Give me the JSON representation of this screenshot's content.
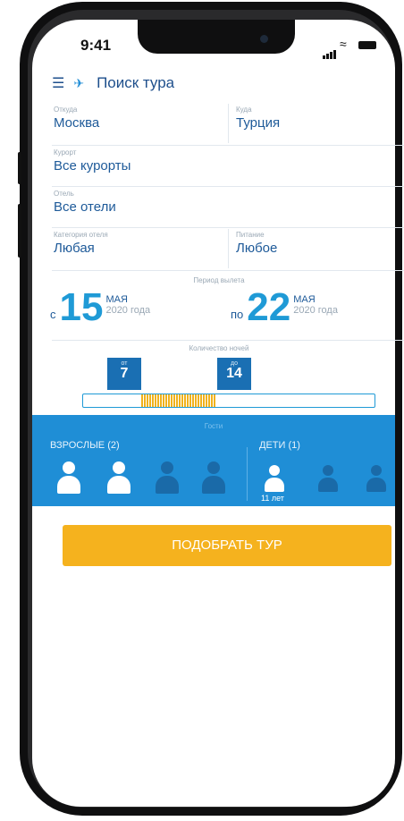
{
  "status_bar": {
    "time": "9:41"
  },
  "header": {
    "title": "Поиск тура"
  },
  "form": {
    "from": {
      "label": "Откуда",
      "value": "Москва"
    },
    "to": {
      "label": "Куда",
      "value": "Турция"
    },
    "resort": {
      "label": "Курорт",
      "value": "Все курорты"
    },
    "hotel": {
      "label": "Отель",
      "value": "Все отели"
    },
    "hotel_category": {
      "label": "Категория отеля",
      "value": "Любая"
    },
    "meals": {
      "label": "Питание",
      "value": "Любое"
    }
  },
  "departure": {
    "label": "Период вылета",
    "from": {
      "prefix": "с",
      "day": "15",
      "month": "МАЯ",
      "year": "2020 года"
    },
    "to": {
      "prefix": "по",
      "day": "22",
      "month": "МАЯ",
      "year": "2020 года"
    }
  },
  "nights": {
    "label": "Количество ночей",
    "min_label": "от",
    "min": "7",
    "max_label": "до",
    "max": "14"
  },
  "guests": {
    "label": "Гости",
    "adults_label": "ВЗРОСЛЫЕ (2)",
    "adults_selected": 2,
    "adults_total": 4,
    "children_label": "ДЕТИ (1)",
    "children_selected": 1,
    "children_total": 3,
    "child_age": "11 лет"
  },
  "actions": {
    "search_label": "ПОДОБРАТЬ ТУР"
  },
  "colors": {
    "accent": "#1f8ed6",
    "button": "#f5b21e",
    "text": "#1e5a99"
  }
}
